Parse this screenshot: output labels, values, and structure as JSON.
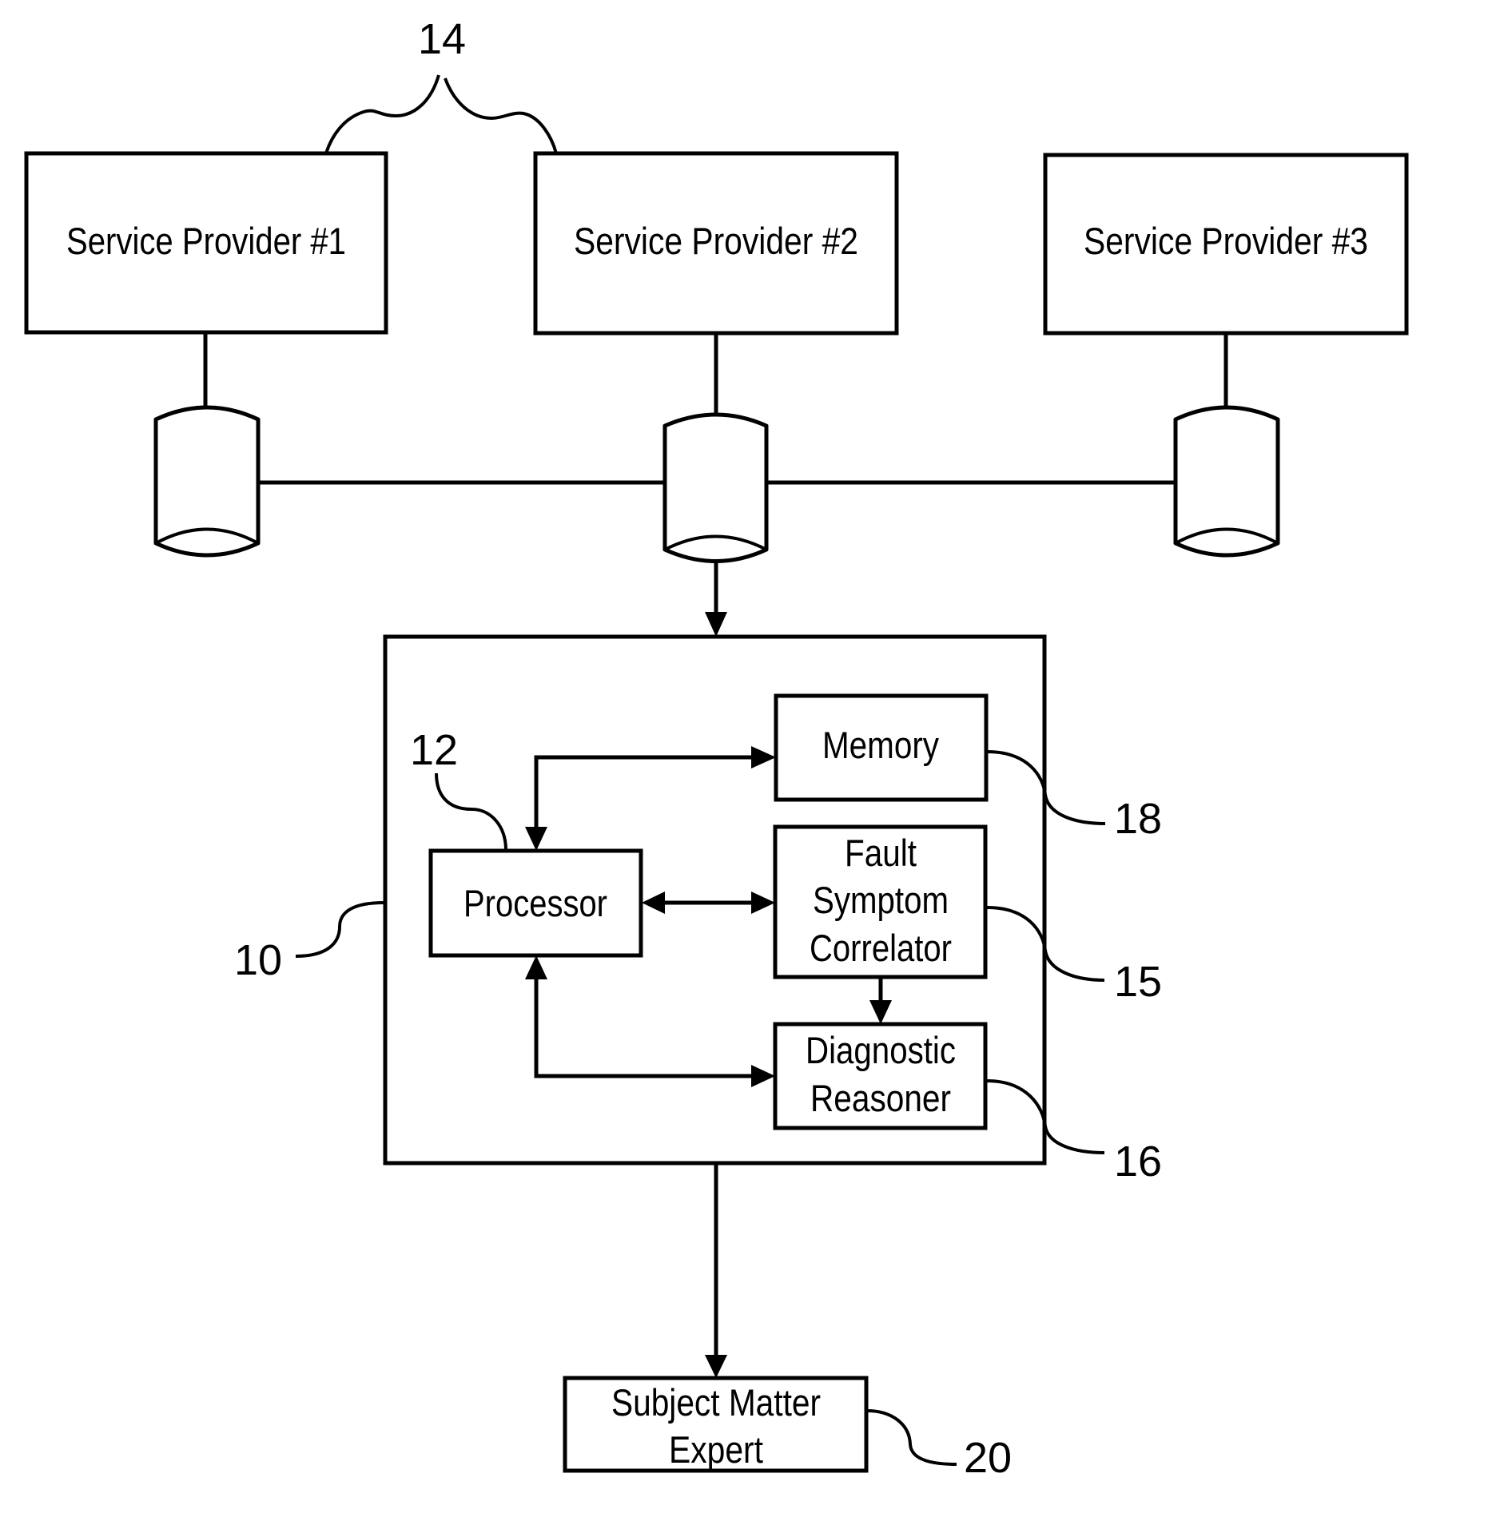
{
  "figure": {
    "providers": [
      {
        "label": "Service Provider #1"
      },
      {
        "label": "Service Provider #2"
      },
      {
        "label": "Service Provider #3"
      }
    ],
    "system": {
      "ref": "10",
      "processor": {
        "label": "Processor",
        "ref": "12"
      },
      "memory": {
        "label": "Memory",
        "ref": "18"
      },
      "fault_symptom_correlator": {
        "lines": [
          "Fault",
          "Symptom",
          "Correlator"
        ],
        "ref": "15"
      },
      "diagnostic_reasoner": {
        "lines": [
          "Diagnostic",
          "Reasoner"
        ],
        "ref": "16"
      }
    },
    "providers_group_ref": "14",
    "subject_matter_expert": {
      "lines": [
        "Subject Matter",
        "Expert"
      ],
      "ref": "20"
    },
    "connections": [
      {
        "from": "Service Provider #1",
        "to": "database-1",
        "type": "line"
      },
      {
        "from": "Service Provider #2",
        "to": "database-2",
        "type": "line"
      },
      {
        "from": "Service Provider #3",
        "to": "database-3",
        "type": "line"
      },
      {
        "from": "database-1",
        "to": "database-2",
        "type": "line"
      },
      {
        "from": "database-2",
        "to": "database-3",
        "type": "line"
      },
      {
        "from": "database-2",
        "to": "system-10",
        "type": "arrow"
      },
      {
        "from": "Processor",
        "to": "Memory",
        "type": "bidirectional-arrow"
      },
      {
        "from": "Processor",
        "to": "Fault Symptom Correlator",
        "type": "bidirectional-arrow"
      },
      {
        "from": "Processor",
        "to": "Diagnostic Reasoner",
        "type": "bidirectional-arrow"
      },
      {
        "from": "Fault Symptom Correlator",
        "to": "Diagnostic Reasoner",
        "type": "arrow"
      },
      {
        "from": "system-10",
        "to": "Subject Matter Expert",
        "type": "arrow"
      }
    ]
  }
}
